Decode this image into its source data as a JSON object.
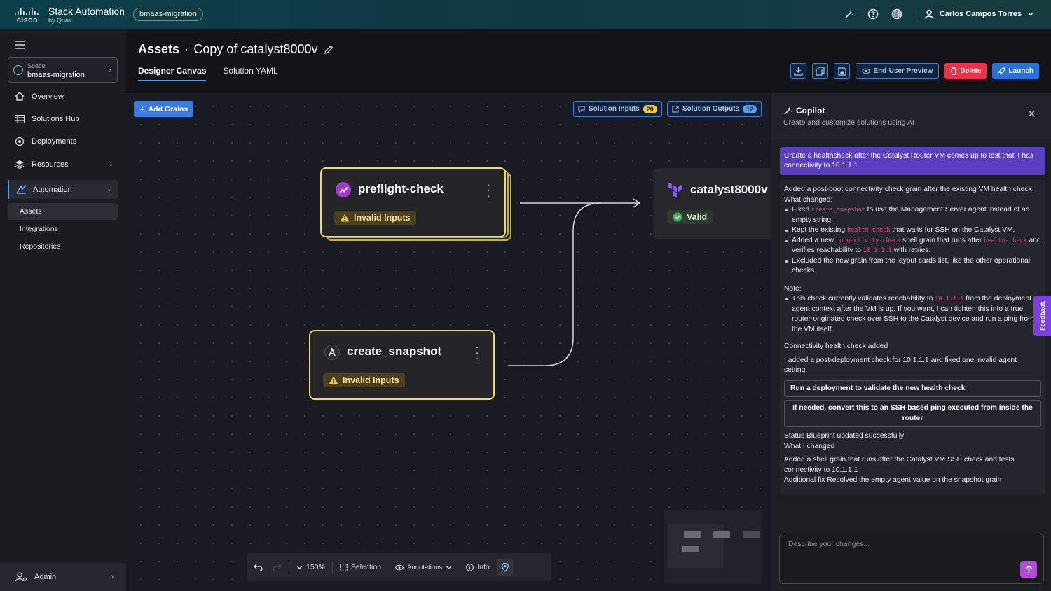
{
  "app": {
    "brand": "Stack Automation",
    "brand_sub": "by Quali",
    "space_pill": "bmaas-migration",
    "user_name": "Carlos Campos Torres"
  },
  "sidebar": {
    "space_label": "Space",
    "space_value": "bmaas-migration",
    "items": [
      {
        "label": "Overview",
        "icon": "home-icon"
      },
      {
        "label": "Solutions Hub",
        "icon": "grid-icon"
      },
      {
        "label": "Deployments",
        "icon": "deploy-icon"
      },
      {
        "label": "Resources",
        "icon": "layers-icon"
      },
      {
        "label": "Automation",
        "icon": "automation-icon"
      }
    ],
    "subitems": [
      "Assets",
      "Integrations",
      "Repositories"
    ],
    "admin": "Admin"
  },
  "header": {
    "breadcrumb_root": "Assets",
    "title": "Copy of catalyst8000v",
    "tabs": [
      "Designer Canvas",
      "Solution YAML"
    ],
    "buttons": {
      "preview": "End-User Preview",
      "delete": "Delete",
      "launch": "Launch"
    }
  },
  "canvas": {
    "add_grains": "Add Grains",
    "solution_inputs": "Solution Inputs",
    "solution_inputs_count": "20",
    "solution_outputs": "Solution Outputs",
    "solution_outputs_count": "12",
    "grains": [
      {
        "name": "preflight-check",
        "status": "Invalid Inputs"
      },
      {
        "name": "create_snapshot",
        "status": "Invalid Inputs"
      },
      {
        "name": "catalyst8000v",
        "status": "Valid"
      }
    ],
    "toolbar": {
      "zoom": "150%",
      "selection": "Selection",
      "annotations": "Annotations",
      "info": "Info"
    }
  },
  "copilot": {
    "title": "Copilot",
    "subtitle": "Create and customize solutions using AI",
    "user_message": "Create a healthcheck after the Catalyst Router VM comes up to test that it has connectivity to 10.1.1.1",
    "intro": "Added a post-boot connectivity check grain after the existing VM health check.",
    "what_changed": "What changed:",
    "b1_a": "Fixed ",
    "b1_code": "create_snapshot",
    "b1_b": " to use the Management Server agent instead of an empty string.",
    "b2_a": "Kept the existing ",
    "b2_code": "health-check",
    "b2_b": " that waits for SSH on the Catalyst VM.",
    "b3_a": "Added a new ",
    "b3_code": "connectivity-check",
    "b3_b": " shell grain that runs after ",
    "b3_code2": "health-check",
    "b3_c": " and verifies reachability to ",
    "b3_code3": "10.1.1.1",
    "b3_d": " with retries.",
    "b4": "Excluded the new grain from the layout cards list, like the other operational checks.",
    "note": "Note:",
    "n1_a": "This check currently validates reachability to ",
    "n1_code": "10.1.1.1",
    "n1_b": " from the deployment agent context after the VM is up. If you want, I can tighten this into a true router-originated check over SSH to the Catalyst device and run a ping from the VM itself.",
    "summary_title": "Connectivity health check added",
    "summary_text": "I added a post-deployment check for 10.1.1.1 and fixed one invalid agent setting.",
    "action1": "Run a deployment to validate the new health check",
    "action2": "If needed, convert this to an SSH-based ping executed from inside the router",
    "status_line": "Status  Blueprint updated successfully",
    "what_i_changed": "What I changed",
    "change_text": "Added a shell grain that runs after the Catalyst VM SSH check and tests connectivity to 10.1.1.1",
    "fix_line": "Additional fix  Resolved the empty agent value on the snapshot grain",
    "input_placeholder": "Describe your changes...",
    "feedback": "Feedback"
  }
}
